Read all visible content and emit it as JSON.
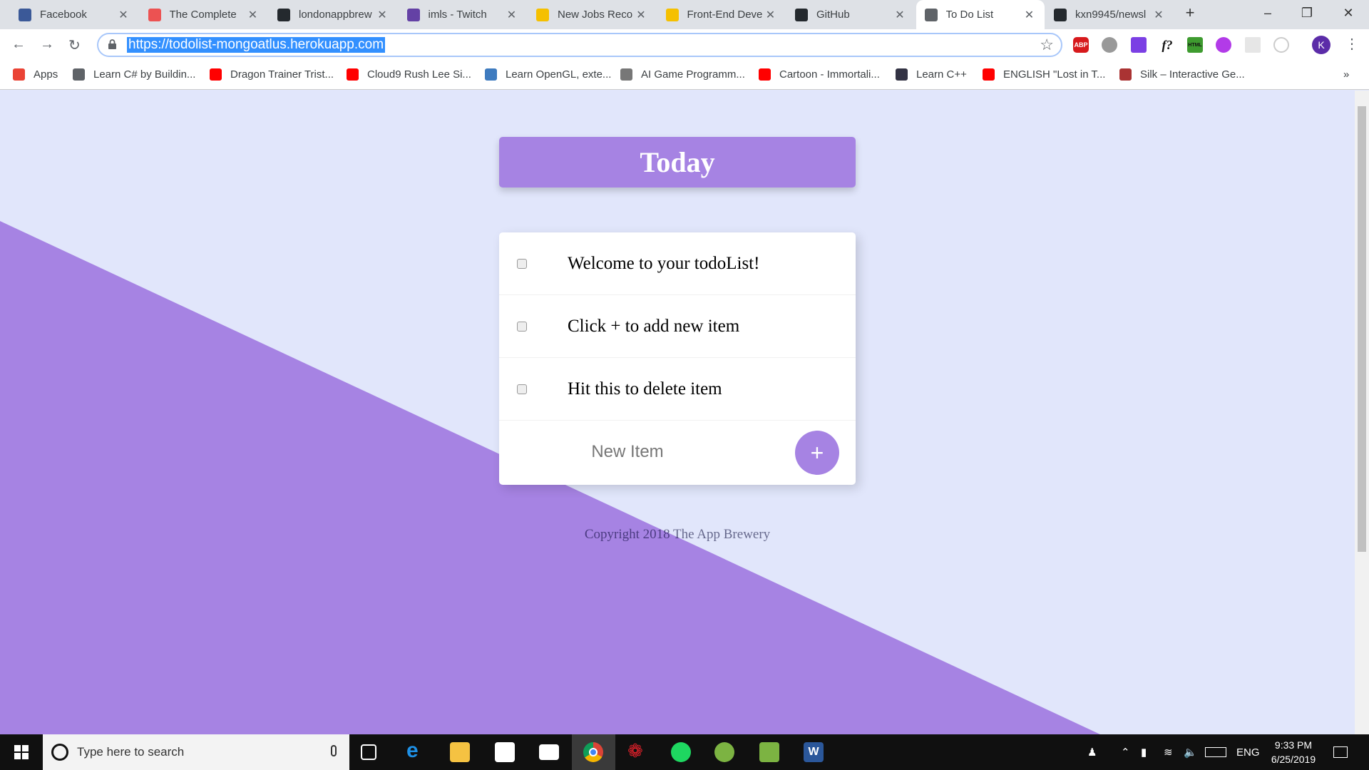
{
  "browser": {
    "tabs": [
      {
        "title": "Facebook",
        "icon": "facebook-icon",
        "color": "#3B5998"
      },
      {
        "title": "The Complete",
        "icon": "udemy-icon",
        "color": "#EC5252"
      },
      {
        "title": "londonappbrew",
        "icon": "github-icon",
        "color": "#24292E"
      },
      {
        "title": "imls - Twitch",
        "icon": "twitch-icon",
        "color": "#6441A5"
      },
      {
        "title": "New Jobs Reco",
        "icon": "indeed-icon",
        "color": "#F5C000"
      },
      {
        "title": "Front-End Deve",
        "icon": "indeed-icon",
        "color": "#F5C000"
      },
      {
        "title": "GitHub",
        "icon": "github-icon",
        "color": "#24292E"
      },
      {
        "title": "To Do List",
        "icon": "globe-icon",
        "color": "#5f6368"
      },
      {
        "title": "kxn9945/newsl",
        "icon": "github-icon",
        "color": "#24292E"
      }
    ],
    "active_tab": 7,
    "url": "https://todolist-mongoatlus.herokuapp.com",
    "profile_initial": "K",
    "extensions": [
      "ABP",
      "bug",
      "eyedropper",
      "f?",
      "HTML",
      "purple",
      "grid",
      "target"
    ],
    "bookmarks": [
      {
        "label": "Apps",
        "icon": "apps-grid-icon"
      },
      {
        "label": "Learn C# by Buildin...",
        "icon": "globe-icon"
      },
      {
        "label": "Dragon Trainer Trist...",
        "icon": "youtube-icon"
      },
      {
        "label": "Cloud9 Rush Lee Si...",
        "icon": "youtube-icon"
      },
      {
        "label": "Learn OpenGL, exte...",
        "icon": "opengl-icon"
      },
      {
        "label": "AI Game Programm...",
        "icon": "gameai-icon"
      },
      {
        "label": "Cartoon - Immortali...",
        "icon": "youtube-icon"
      },
      {
        "label": "Learn C++",
        "icon": "cpp-icon"
      },
      {
        "label": "ENGLISH \"Lost in T...",
        "icon": "youtube-icon"
      },
      {
        "label": "Silk – Interactive Ge...",
        "icon": "silk-icon"
      }
    ],
    "more_bookmarks": "»"
  },
  "app": {
    "heading": "Today",
    "items": [
      {
        "text": "Welcome to your todoList!",
        "checked": false
      },
      {
        "text": "Click + to add new item",
        "checked": false
      },
      {
        "text": "Hit this to delete item",
        "checked": false
      }
    ],
    "new_item_placeholder": "New Item",
    "add_label": "+",
    "footer": "Copyright 2018 The App Brewery",
    "colors": {
      "accent": "#A683E3",
      "background": "#E1E6FB"
    }
  },
  "taskbar": {
    "search_placeholder": "Type here to search",
    "language": "ENG",
    "time": "9:33 PM",
    "date": "6/25/2019"
  }
}
